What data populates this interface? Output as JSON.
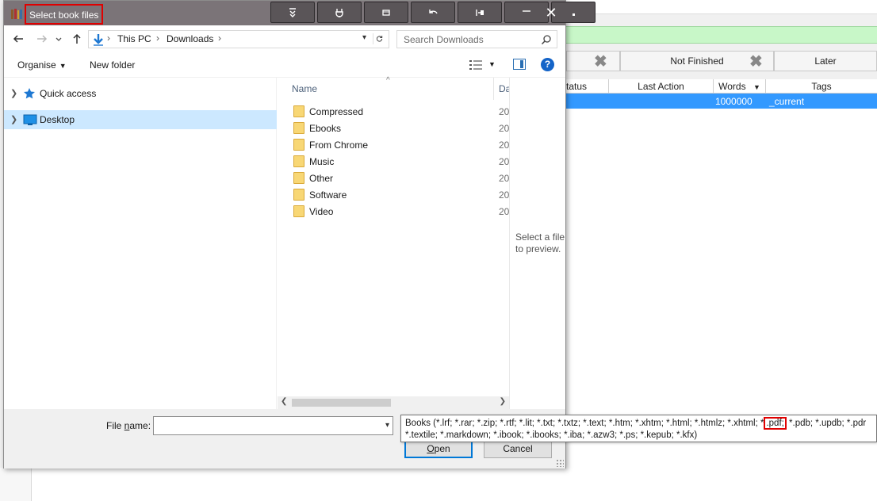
{
  "dialog": {
    "title": "Select book files",
    "close_glyph": "✕"
  },
  "address": {
    "crumbs": [
      "This PC",
      "Downloads"
    ],
    "separator": "›"
  },
  "search": {
    "placeholder": "Search Downloads"
  },
  "commands": {
    "organise": "Organise",
    "new_folder": "New folder",
    "help": "?"
  },
  "nav_pane": {
    "items": [
      {
        "label": "Quick access",
        "icon": "star-icon",
        "selected": false
      },
      {
        "label": "Desktop",
        "icon": "desktop-icon",
        "selected": true
      }
    ]
  },
  "file_list": {
    "header_name": "Name",
    "header_date": "Da",
    "items": [
      {
        "name": "Compressed",
        "date": "20"
      },
      {
        "name": "Ebooks",
        "date": "20"
      },
      {
        "name": "From Chrome",
        "date": "20"
      },
      {
        "name": "Music",
        "date": "20"
      },
      {
        "name": "Other",
        "date": "20"
      },
      {
        "name": "Software",
        "date": "20"
      },
      {
        "name": "Video",
        "date": "20"
      }
    ]
  },
  "preview": {
    "text": "Select a file to preview."
  },
  "footer": {
    "file_name_label_pre": "File ",
    "file_name_label_u": "n",
    "file_name_label_post": "ame:",
    "file_name_value": "",
    "open_u": "O",
    "open_rest": "pen",
    "cancel": "Cancel"
  },
  "type_list": {
    "line1_pre": "Books (*.lrf; *.rar; *.zip; *.rtf; *.lit; *.txt; *.txtz; *.text; *.htm; *.xhtm; *.html; *.htmlz; *.xhtml; *",
    "line1_hl": ".pdf;",
    "line1_post": " *.pdb; *.updb; *.pdr",
    "line2": "*.textile; *.markdown; *.ibook; *.ibooks; *.iba; *.azw3; *.ps; *.kepub; *.kfx)"
  },
  "background": {
    "tab_not_finished": "Not Finished",
    "tab_later": "Later",
    "col_status": "tatus",
    "col_last_action": "Last Action",
    "col_words": "Words",
    "col_tags": "Tags",
    "row_words": "1000000",
    "row_tags": "_current"
  },
  "colors": {
    "titlebar": "#7b7478",
    "selection": "#cce8ff",
    "accent": "#0078d7",
    "highlight_box": "#e00000",
    "green_bar": "#c8f7c8",
    "row_selected": "#3399ff"
  }
}
